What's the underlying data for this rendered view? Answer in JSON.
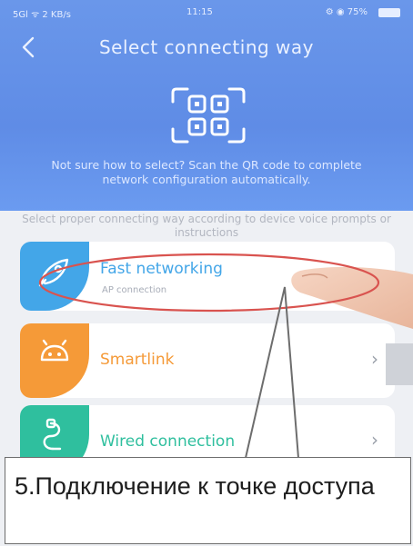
{
  "status_bar": {
    "left": "5Gl ᯤ 2 KB/s",
    "time": "11:15",
    "right": "⚙ ◉ 75%"
  },
  "header": {
    "title": "Select connecting way",
    "scan_message": "Not sure how to select? Scan the QR code to complete network configuration automatically."
  },
  "hint": "Select proper connecting way according to device voice prompts or instructions",
  "options": [
    {
      "label": "Fast networking",
      "sub": "AP connection",
      "color": "#43a6e8"
    },
    {
      "label": "Smartlink",
      "sub": "",
      "color": "#f59a38"
    },
    {
      "label": "Wired connection",
      "sub": "",
      "color": "#2fbf9e"
    }
  ],
  "caption": "5.Подключение к точке доступа",
  "colors": {
    "header": "#6a97ea",
    "highlight_ellipse": "#d9534f",
    "fast": "#43a6e8",
    "smartlink": "#f59a38",
    "wired": "#2fbf9e"
  }
}
